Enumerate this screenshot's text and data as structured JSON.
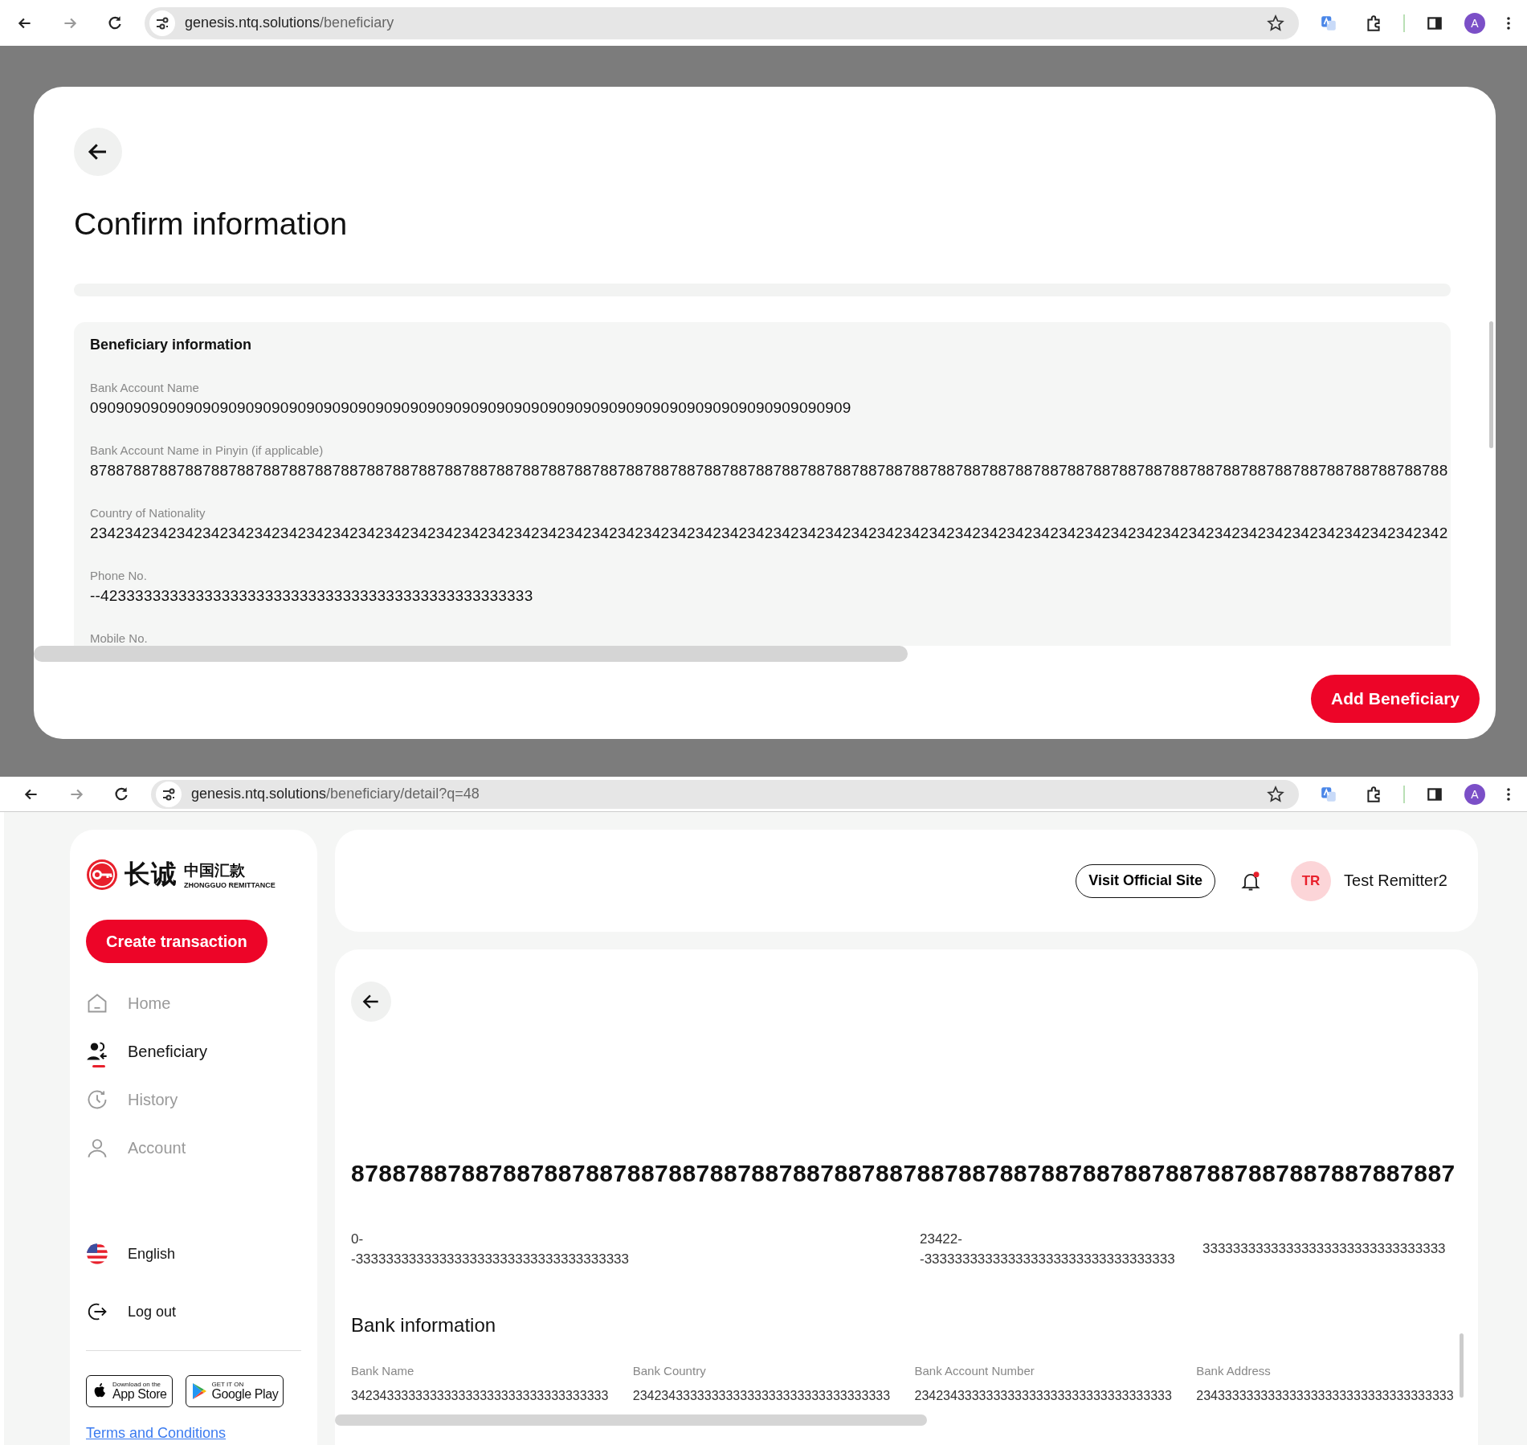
{
  "browser_top": {
    "url_host": "genesis.ntq.solutions",
    "url_path": "/beneficiary",
    "profile_initial": "A"
  },
  "confirm_modal": {
    "title": "Confirm information",
    "section_title": "Beneficiary information",
    "fields": [
      {
        "label": "Bank Account Name",
        "value": "0909090909090909090909090909090909090909090909090909090909090909090909090909090909090909"
      },
      {
        "label": "Bank Account Name in Pinyin (if applicable)",
        "value": "8788788788788788788788788788788788788788788788788788788788788788788788788788788788788788788788788788788788788788788788788788788788788788788788788788788788788"
      },
      {
        "label": "Country of Nationality",
        "value": "2342342342342342342342342342342342342342342342342342342342342342342342342342342342342342342342342342342342342342342342342342342342342342342342342342342342342"
      },
      {
        "label": "Phone No.",
        "value": "--42333333333333333333333333333333333333333333333333"
      },
      {
        "label": "Mobile No."
      }
    ],
    "submit_button": "Add Beneficiary"
  },
  "browser_bottom": {
    "url_host": "genesis.ntq.solutions",
    "url_path": "/beneficiary/detail?q=48",
    "profile_initial": "A"
  },
  "sidebar": {
    "logo_cn": "长诚",
    "logo_cn_small": "中国汇款",
    "logo_en": "ZHONGGUO REMITTANCE",
    "create_button": "Create transaction",
    "nav": [
      {
        "label": "Home",
        "kind": "home",
        "selected": false
      },
      {
        "label": "Beneficiary",
        "kind": "beneficiary",
        "selected": true
      },
      {
        "label": "History",
        "kind": "history",
        "selected": false
      },
      {
        "label": "Account",
        "kind": "account",
        "selected": false
      }
    ],
    "language": "English",
    "logout": "Log out",
    "app_store": {
      "small": "Download on the",
      "big": "App Store"
    },
    "google_play": {
      "small": "GET IT ON",
      "big": "Google Play"
    },
    "terms_link": "Terms and Conditions"
  },
  "header": {
    "site_button": "Visit Official Site",
    "notification_dot": true,
    "avatar_initials": "TR",
    "user_name": "Test Remitter2"
  },
  "detail": {
    "name_heading": "87887887887887887887887887887887887887887887887887887887887887887887887887887887",
    "info_values": [
      {
        "lines": [
          "0-",
          "-333333333333333333333333333333333333"
        ]
      },
      {
        "lines": [
          "23422-",
          "-333333333333333333333333333333333"
        ]
      },
      {
        "lines": [
          "33333333333333333333333333333333"
        ]
      }
    ],
    "bank_section_title": "Bank information",
    "bank_fields": [
      {
        "label": "Bank Name",
        "value": "342343333333333333333333333333333333"
      },
      {
        "label": "Bank Country",
        "value": "234234333333333333333333333333333333"
      },
      {
        "label": "Bank Account Number",
        "value": "234234333333333333333333333333333333"
      },
      {
        "label": "Bank Address",
        "value": "234333333333333333333333333333333333"
      }
    ]
  }
}
